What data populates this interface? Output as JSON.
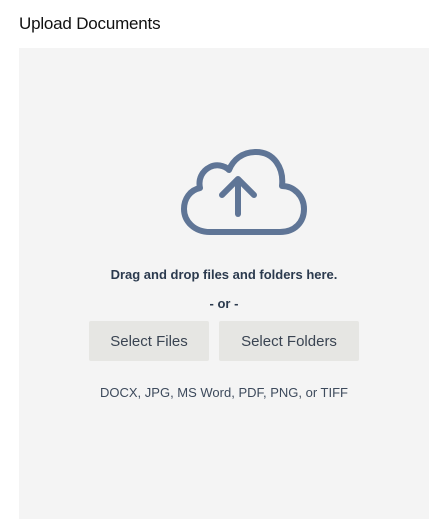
{
  "header": {
    "title": "Upload Documents"
  },
  "dropzone": {
    "icon": "cloud-upload-icon",
    "icon_color": "#5f7596",
    "background": "#f4f4f4",
    "instruction": "Drag and drop files and folders here.",
    "separator": "- or -",
    "select_files_label": "Select Files",
    "select_folders_label": "Select Folders",
    "accepted_formats": "DOCX, JPG, MS Word, PDF, PNG, or TIFF"
  }
}
